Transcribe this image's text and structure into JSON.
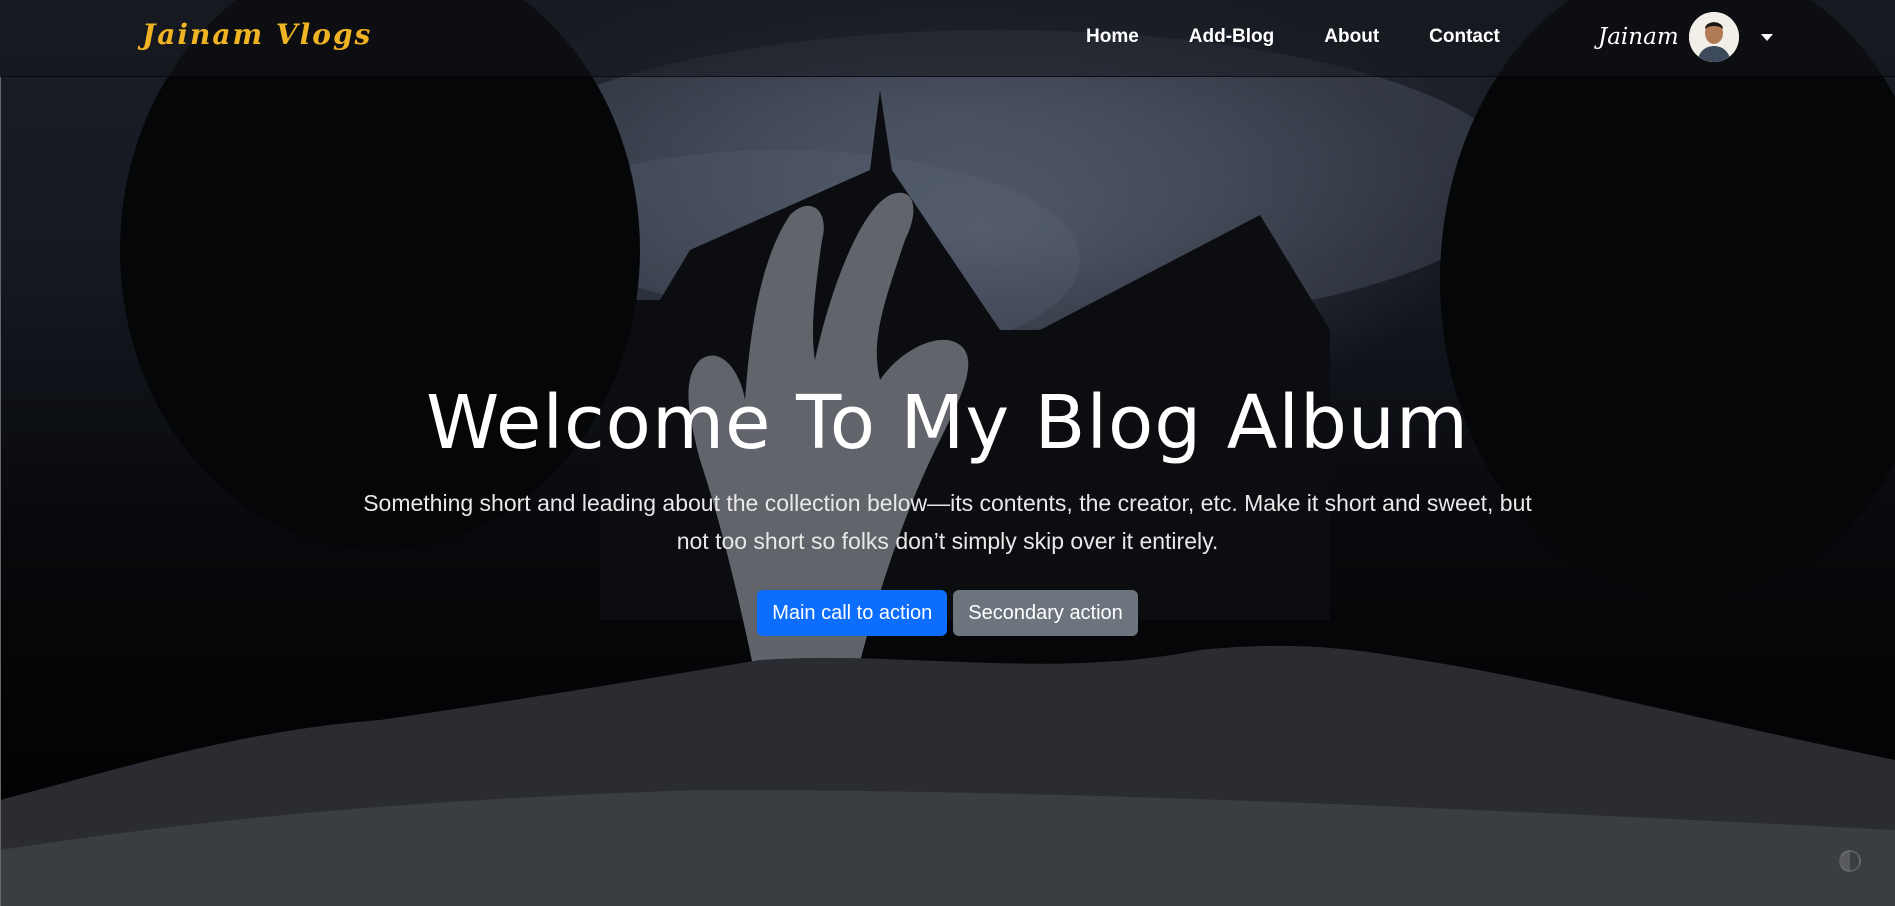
{
  "navbar": {
    "brand": "Jainam Vlogs",
    "links": [
      {
        "label": "Home"
      },
      {
        "label": "Add-Blog"
      },
      {
        "label": "About"
      },
      {
        "label": "Contact"
      }
    ],
    "user": {
      "name": "Jainam"
    }
  },
  "hero": {
    "title": "Welcome To My Blog Album",
    "text": "Something short and leading about the collection below—its contents, the creator, etc. Make it short and sweet, but not too short so folks don’t simply skip over it entirely.",
    "primary_button": "Main call to action",
    "secondary_button": "Secondary action"
  },
  "colors": {
    "brand": "#f0b323",
    "primary": "#0d6efd",
    "secondary": "#6c757d"
  },
  "icons": {
    "dropdown": "chevron-down-icon",
    "theme": "theme-toggle-icon"
  }
}
